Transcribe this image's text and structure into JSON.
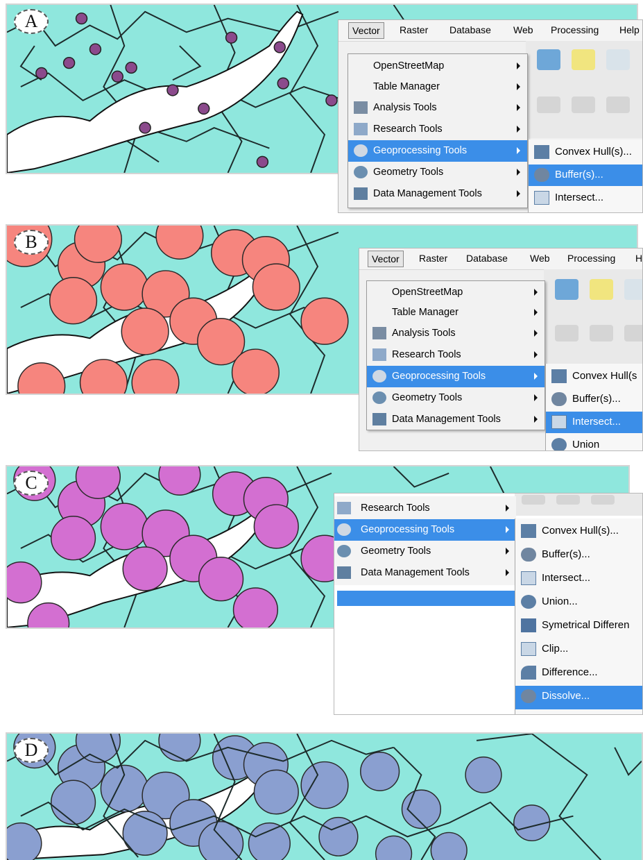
{
  "colors": {
    "map_background": "#8fe7dd",
    "boundary_line": "#1d2b2b",
    "river": "#ffffff",
    "points_a": "#8b4a8c",
    "buffer_b": "#f6857e",
    "intersect_c": "#d36fd1",
    "dissolve_d": "#8a9fd0",
    "menu_highlight": "#3b8ee8"
  },
  "panels": [
    {
      "badge": "A",
      "menubar": [
        "Vector",
        "Raster",
        "Database",
        "Web",
        "Processing",
        "Help"
      ],
      "menu": [
        {
          "label": "OpenStreetMap",
          "icon": "none"
        },
        {
          "label": "Table Manager",
          "icon": "none"
        },
        {
          "label": "Analysis Tools",
          "icon": "analysis-icon"
        },
        {
          "label": "Research Tools",
          "icon": "research-icon"
        },
        {
          "label": "Geoprocessing Tools",
          "icon": "gear-icon",
          "selected": true
        },
        {
          "label": "Geometry Tools",
          "icon": "geometry-icon"
        },
        {
          "label": "Data Management Tools",
          "icon": "layers-icon"
        }
      ],
      "submenu": [
        {
          "label": "Convex Hull(s)...",
          "icon": "convex-hull-icon"
        },
        {
          "label": "Buffer(s)...",
          "icon": "buffer-icon",
          "selected": true
        },
        {
          "label": "Intersect...",
          "icon": "intersect-icon"
        }
      ]
    },
    {
      "badge": "B",
      "menubar": [
        "Vector",
        "Raster",
        "Database",
        "Web",
        "Processing",
        "H"
      ],
      "menu": [
        {
          "label": "OpenStreetMap",
          "icon": "none"
        },
        {
          "label": "Table Manager",
          "icon": "none"
        },
        {
          "label": "Analysis Tools",
          "icon": "analysis-icon"
        },
        {
          "label": "Research Tools",
          "icon": "research-icon"
        },
        {
          "label": "Geoprocessing Tools",
          "icon": "gear-icon",
          "selected": true
        },
        {
          "label": "Geometry Tools",
          "icon": "geometry-icon"
        },
        {
          "label": "Data Management Tools",
          "icon": "layers-icon"
        }
      ],
      "submenu": [
        {
          "label": "Convex Hull(s",
          "icon": "convex-hull-icon"
        },
        {
          "label": "Buffer(s)...",
          "icon": "buffer-icon"
        },
        {
          "label": "Intersect...",
          "icon": "intersect-icon",
          "selected": true
        },
        {
          "label": "Union",
          "icon": "union-icon"
        }
      ]
    },
    {
      "badge": "C",
      "menu": [
        {
          "label": "Research Tools",
          "icon": "research-icon"
        },
        {
          "label": "Geoprocessing Tools",
          "icon": "gear-icon",
          "selected": true
        },
        {
          "label": "Geometry Tools",
          "icon": "geometry-icon"
        },
        {
          "label": "Data Management Tools",
          "icon": "layers-icon"
        }
      ],
      "submenu": [
        {
          "label": "Convex Hull(s)...",
          "icon": "convex-hull-icon"
        },
        {
          "label": "Buffer(s)...",
          "icon": "buffer-icon"
        },
        {
          "label": "Intersect...",
          "icon": "intersect-icon"
        },
        {
          "label": "Union...",
          "icon": "union-icon"
        },
        {
          "label": "Symetrical Differen",
          "icon": "sym-difference-icon"
        },
        {
          "label": "Clip...",
          "icon": "clip-icon"
        },
        {
          "label": "Difference...",
          "icon": "difference-icon"
        },
        {
          "label": "Dissolve...",
          "icon": "dissolve-icon",
          "selected": true
        }
      ]
    },
    {
      "badge": "D"
    }
  ]
}
